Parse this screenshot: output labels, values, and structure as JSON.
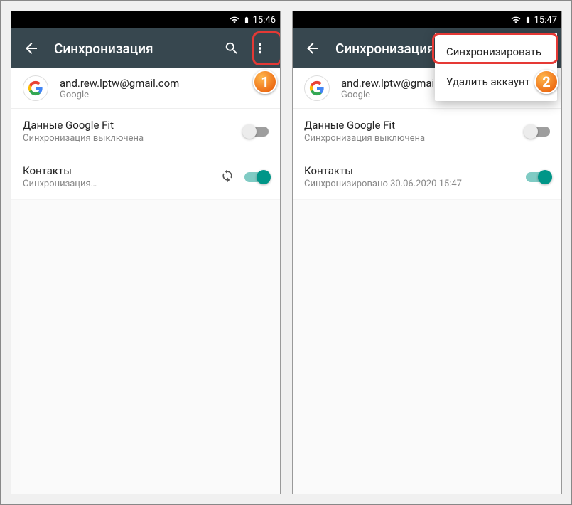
{
  "left": {
    "status": {
      "time": "15:46"
    },
    "toolbar": {
      "title": "Синхронизация"
    },
    "account": {
      "email": "and.rew.lptw@gmail.com",
      "provider": "Google"
    },
    "items": [
      {
        "label": "Данные Google Fit",
        "sub": "Синхронизация выключена",
        "on": false,
        "syncing": false
      },
      {
        "label": "Контакты",
        "sub": "Синхронизация…",
        "on": true,
        "syncing": true
      }
    ],
    "badge": "1"
  },
  "right": {
    "status": {
      "time": "15:47"
    },
    "toolbar": {
      "title": "Синхронизация"
    },
    "account": {
      "email": "and.rew.lptw@gmail.com",
      "provider": "Google"
    },
    "items": [
      {
        "label": "Данные Google Fit",
        "sub": "Синхронизация выключена",
        "on": false,
        "syncing": false
      },
      {
        "label": "Контакты",
        "sub": "Синхронизировано 30.06.2020 15:47",
        "on": true,
        "syncing": false
      }
    ],
    "menu": {
      "sync": "Синхронизировать",
      "delete": "Удалить аккаунт"
    },
    "badge": "2"
  }
}
